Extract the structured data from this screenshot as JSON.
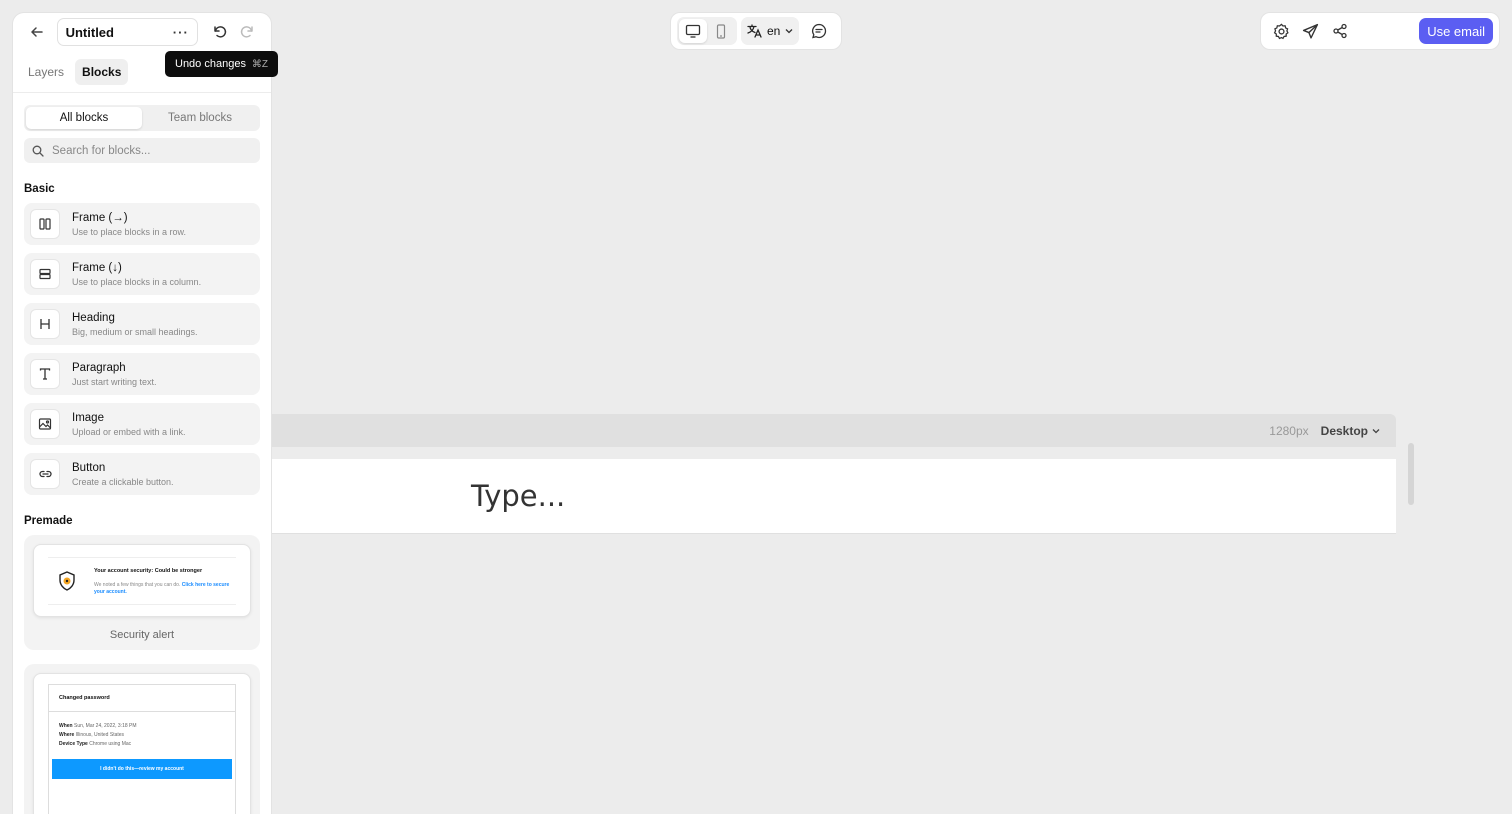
{
  "app": {
    "document_title": "Untitled",
    "tabs": [
      {
        "label": "Layers",
        "active": false
      },
      {
        "label": "Blocks",
        "active": true
      }
    ]
  },
  "tooltip": {
    "label": "Undo changes",
    "shortcut": "⌘Z"
  },
  "blocks_panel": {
    "scope_tabs": [
      {
        "label": "All blocks",
        "active": true
      },
      {
        "label": "Team blocks",
        "active": false
      }
    ],
    "search": {
      "placeholder": "Search for blocks...",
      "value": ""
    },
    "basic_heading": "Basic",
    "basic_items": [
      {
        "name": "Frame (→)",
        "description": "Use to place blocks in a row.",
        "icon": "columns-icon"
      },
      {
        "name": "Frame (↓)",
        "description": "Use to place blocks in a column.",
        "icon": "rows-icon"
      },
      {
        "name": "Heading",
        "description": "Big, medium or small headings.",
        "icon": "heading-icon"
      },
      {
        "name": "Paragraph",
        "description": "Just start writing text.",
        "icon": "text-icon"
      },
      {
        "name": "Image",
        "description": "Upload or embed with a link.",
        "icon": "image-icon"
      },
      {
        "name": "Button",
        "description": "Create a clickable button.",
        "icon": "link-icon"
      }
    ],
    "premade_heading": "Premade",
    "premade_items": [
      {
        "caption": "Security alert",
        "preview_title": "Your account security: Could be stronger",
        "preview_body": "We noted a few things that you can do.",
        "preview_link": "Click here to secure your account."
      },
      {
        "preview_title": "Changed password",
        "rows": [
          {
            "label": "When",
            "value": "Sun, Mar 24, 2022, 3:18 PM"
          },
          {
            "label": "Where",
            "value": "Illinous, United States"
          },
          {
            "label": "Device Type",
            "value": "Chrome using Mac"
          }
        ],
        "preview_button": "I didn't do this—review my account"
      }
    ]
  },
  "toolbar_center": {
    "language": "en",
    "active_device": "desktop"
  },
  "toolbar_right": {
    "cta_label": "Use email",
    "cta_color": "#5b5ef2"
  },
  "canvas": {
    "width_label": "1280px",
    "view_label": "Desktop",
    "placeholder": "Type..."
  }
}
